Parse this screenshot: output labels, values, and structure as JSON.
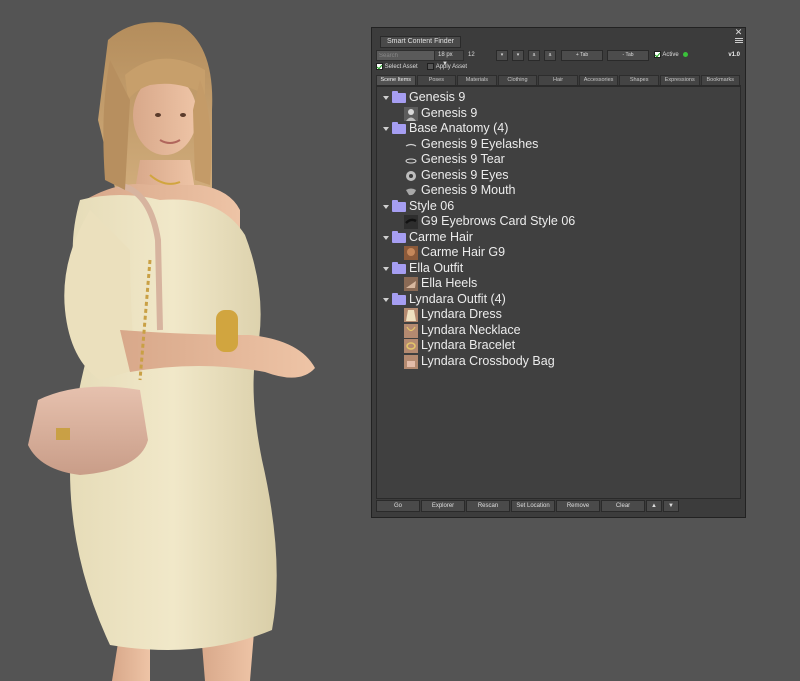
{
  "panel": {
    "title": "Smart Content Finder",
    "close_glyph": "✕",
    "version": "v1.0",
    "accent_color": "#a69ef2",
    "toolbar": {
      "search_placeholder": "Search",
      "font_size": "18 px",
      "font_size_arrow": "▼",
      "count": "12",
      "btn_down": "▾",
      "btn_down2": "▾",
      "btn_a1": "a",
      "btn_a2": "a",
      "add_tab": "+ Tab",
      "remove_tab": "- Tab",
      "active_label": "Active",
      "active_color": "#3ac13a"
    },
    "asset_options": {
      "select_asset": "Select Asset",
      "apply_asset": "Apply Asset"
    },
    "tabs": [
      "Scene Items",
      "Poses",
      "Materials",
      "Clothing",
      "Hair",
      "Accessories",
      "Shapes",
      "Expressions",
      "Bookmarks"
    ],
    "tree": [
      {
        "label": "Genesis 9",
        "type": "folder",
        "icon": "folder-icon"
      },
      {
        "label": "Genesis 9",
        "type": "item",
        "icon": "figure-icon"
      },
      {
        "label": "Base Anatomy (4)",
        "type": "folder",
        "icon": "folder-icon"
      },
      {
        "label": "Genesis 9 Eyelashes",
        "type": "item",
        "icon": "eyelashes-icon"
      },
      {
        "label": "Genesis 9 Tear",
        "type": "item",
        "icon": "tear-icon"
      },
      {
        "label": "Genesis 9 Eyes",
        "type": "item",
        "icon": "eye-icon"
      },
      {
        "label": "Genesis 9 Mouth",
        "type": "item",
        "icon": "mouth-icon"
      },
      {
        "label": "Style 06",
        "type": "folder",
        "icon": "folder-icon"
      },
      {
        "label": "G9 Eyebrows Card Style 06",
        "type": "item",
        "icon": "eyebrows-icon"
      },
      {
        "label": "Carme Hair",
        "type": "folder",
        "icon": "folder-icon"
      },
      {
        "label": "Carme Hair G9",
        "type": "item",
        "icon": "hair-icon"
      },
      {
        "label": "Ella Outfit",
        "type": "folder",
        "icon": "folder-icon"
      },
      {
        "label": "Ella Heels",
        "type": "item",
        "icon": "heels-icon"
      },
      {
        "label": "Lyndara Outfit (4)",
        "type": "folder",
        "icon": "folder-icon"
      },
      {
        "label": "Lyndara Dress",
        "type": "item",
        "icon": "dress-icon"
      },
      {
        "label": "Lyndara Necklace",
        "type": "item",
        "icon": "necklace-icon"
      },
      {
        "label": "Lyndara Bracelet",
        "type": "item",
        "icon": "bracelet-icon"
      },
      {
        "label": "Lyndara Crossbody Bag",
        "type": "item",
        "icon": "bag-icon"
      }
    ],
    "bottom_buttons": {
      "go": "Go",
      "explorer": "Explorer",
      "rescan": "Rescan",
      "set_location": "Set Location",
      "remove": "Remove",
      "clear": "Clear",
      "up": "▲",
      "down": "▼"
    }
  }
}
